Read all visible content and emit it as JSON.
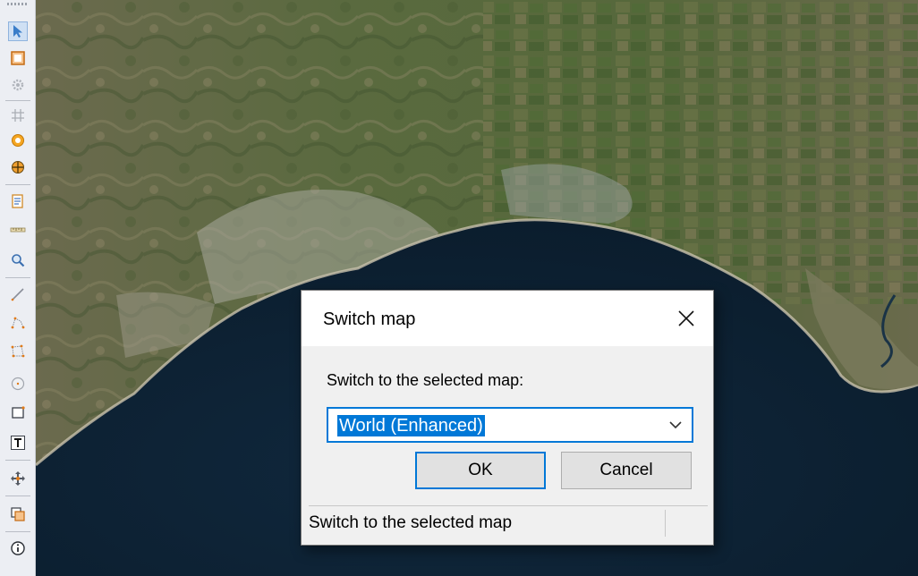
{
  "map": {
    "colors": {
      "sea": "#0e2336",
      "land": "#5e6a43",
      "urban": "#a8a79d",
      "coast": "#c9c2ad"
    }
  },
  "toolbar": {
    "tools": [
      {
        "name": "select-arrow-icon",
        "active": true
      },
      {
        "name": "layer-frame-icon"
      },
      {
        "name": "settings-gear-icon"
      },
      {
        "name": "grid-icon"
      },
      {
        "name": "circle-marker-icon"
      },
      {
        "name": "compass-target-icon"
      },
      {
        "name": "document-list-icon"
      },
      {
        "name": "ruler-icon"
      },
      {
        "name": "zoom-magnifier-icon"
      },
      {
        "name": "pencil-line-icon"
      },
      {
        "name": "polyline-icon"
      },
      {
        "name": "polygon-icon"
      },
      {
        "name": "circle-tool-icon"
      },
      {
        "name": "rectangle-tool-icon"
      },
      {
        "name": "text-tool-icon"
      },
      {
        "name": "move-pan-icon"
      },
      {
        "name": "overlay-copy-icon"
      },
      {
        "name": "info-icon"
      }
    ]
  },
  "dialog": {
    "title": "Switch map",
    "prompt": "Switch to the selected map:",
    "selected_map": "World (Enhanced)",
    "ok_label": "OK",
    "cancel_label": "Cancel",
    "status_text": "Switch to the selected map",
    "accent_color": "#0078d7"
  }
}
